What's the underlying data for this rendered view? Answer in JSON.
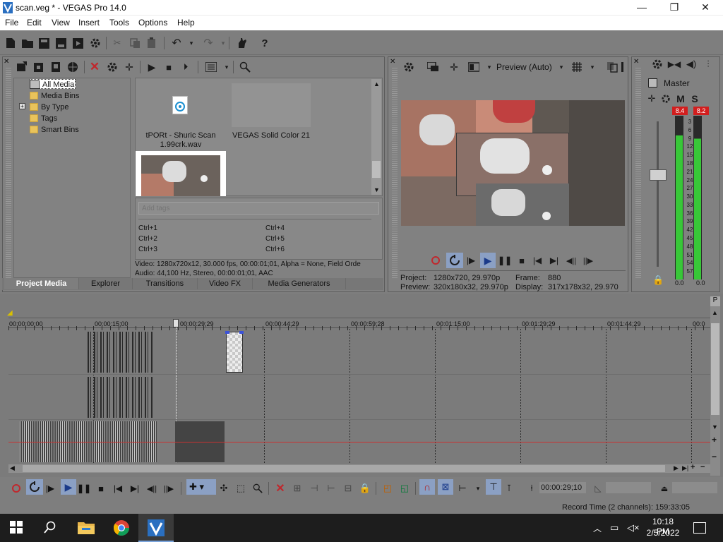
{
  "window": {
    "title": "scan.veg * - VEGAS Pro 14.0",
    "minimize": "—",
    "maximize": "❐",
    "close": "✕"
  },
  "menu": [
    "File",
    "Edit",
    "View",
    "Insert",
    "Tools",
    "Options",
    "Help"
  ],
  "media": {
    "tree": [
      "All Media",
      "Media Bins",
      "By Type",
      "Tags",
      "Smart Bins"
    ],
    "tree_expander": "+",
    "items": [
      {
        "name": "tPORt - Shuric Scan 1.99crk.wav",
        "kind": "audio"
      },
      {
        "name": "VEGAS Solid Color 21",
        "kind": "solid"
      },
      {
        "name": "",
        "kind": "video"
      }
    ],
    "tags_placeholder": "Add tags",
    "shortcuts": [
      "Ctrl+1",
      "Ctrl+4",
      "Ctrl+2",
      "Ctrl+5",
      "Ctrl+3",
      "Ctrl+6"
    ],
    "info_video": "Video: 1280x720x12, 30.000 fps, 00:00:01;01, Alpha = None, Field Orde",
    "info_audio": "Audio: 44,100 Hz, Stereo, 00:00:01;01, AAC",
    "tabs": [
      "Project Media",
      "Explorer",
      "Transitions",
      "Video FX",
      "Media Generators"
    ]
  },
  "preview": {
    "quality_label": "Preview (Auto)",
    "project_label": "Project:",
    "project_value": "1280x720, 29.970p",
    "preview_label": "Preview:",
    "preview_value": "320x180x32, 29.970p",
    "frame_label": "Frame:",
    "frame_value": "880",
    "display_label": "Display:",
    "display_value": "317x178x32, 29.970"
  },
  "master": {
    "label": "Master",
    "m": "M",
    "s": "S",
    "peak_left": "8.4",
    "peak_right": "8.2",
    "scale": [
      "3",
      "6",
      "9",
      "12",
      "15",
      "18",
      "21",
      "24",
      "27",
      "30",
      "33",
      "36",
      "39",
      "42",
      "45",
      "48",
      "51",
      "54",
      "57"
    ],
    "bottom_left": "0.0",
    "bottom_right": "0.0",
    "level_left": 0.88,
    "level_right": 0.86
  },
  "timeline": {
    "ticks": [
      "00:00:00;00",
      "00:00:15;00",
      "00:00:29;29",
      "00:00:44;29",
      "00:00:59;28",
      "00:01:15;00",
      "00:01:29;29",
      "00:01:44;29",
      "00:0"
    ]
  },
  "transport": {
    "time": "00:00:29;10"
  },
  "status": {
    "record_time": "Record Time (2 channels): 159:33:05"
  },
  "taskbar": {
    "time": "10:18 PM",
    "date": "2/5/2022"
  },
  "colors": {
    "accent_blue": "#1a6fd1",
    "meter_green": "#38c738",
    "peak_red": "#d21e1e"
  }
}
